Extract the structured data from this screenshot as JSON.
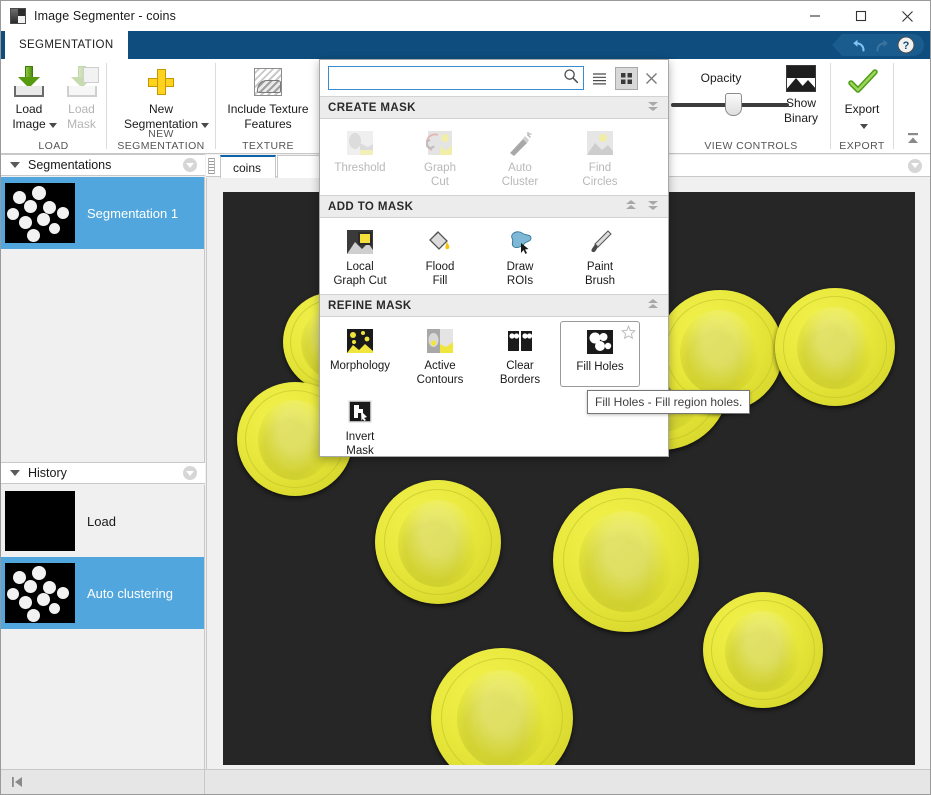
{
  "window": {
    "title": "Image Segmenter - coins",
    "app_icon": "image-segmenter-icon",
    "minimize": "minimize-icon",
    "maximize": "maximize-icon",
    "close": "close-icon"
  },
  "tabstrip": {
    "active_tab": "SEGMENTATION",
    "quick_access": {
      "undo": "undo-icon",
      "redo": "redo-icon",
      "help": "help-icon"
    }
  },
  "ribbon": {
    "groups": [
      {
        "label": "LOAD",
        "buttons": [
          {
            "label": "Load\nImage",
            "icon": "load-image-icon",
            "enabled": true,
            "has_caret": true
          },
          {
            "label": "Load\nMask",
            "icon": "load-mask-icon",
            "enabled": false,
            "has_caret": false
          }
        ]
      },
      {
        "label": "NEW SEGMENTATION",
        "buttons": [
          {
            "label": "New\nSegmentation",
            "icon": "new-segmentation-icon",
            "enabled": true,
            "has_caret": true
          }
        ]
      },
      {
        "label": "TEXTURE",
        "buttons": [
          {
            "label": "Include Texture\nFeatures",
            "icon": "texture-icon",
            "enabled": true,
            "has_caret": false
          }
        ]
      },
      {
        "label": "VIEW CONTROLS",
        "buttons": [
          {
            "label": "Opacity",
            "icon": "opacity-slider",
            "enabled": true,
            "has_caret": false
          },
          {
            "label": "Show\nBinary",
            "icon": "show-binary-icon",
            "enabled": true,
            "has_caret": false
          }
        ]
      },
      {
        "label": "EXPORT",
        "buttons": [
          {
            "label": "Export",
            "icon": "export-icon",
            "enabled": true,
            "has_caret": true
          }
        ]
      }
    ],
    "collapse_icon": "ribbon-collapse-icon"
  },
  "gallery": {
    "search": {
      "value": "",
      "placeholder": "",
      "icon": "search-icon"
    },
    "view_list_icon": "list-view-icon",
    "view_grid_icon": "grid-view-icon",
    "view_mode": "grid",
    "close_icon": "close-icon",
    "sections": [
      {
        "title": "CREATE MASK",
        "scroll_up": false,
        "scroll_down": true,
        "items": [
          {
            "label": "Threshold",
            "icon": "threshold-icon",
            "enabled": false
          },
          {
            "label": "Graph\nCut",
            "icon": "graph-cut-icon",
            "enabled": false
          },
          {
            "label": "Auto\nCluster",
            "icon": "auto-cluster-icon",
            "enabled": false
          },
          {
            "label": "Find\nCircles",
            "icon": "find-circles-icon",
            "enabled": false
          }
        ]
      },
      {
        "title": "ADD TO MASK",
        "scroll_up": true,
        "scroll_down": true,
        "items": [
          {
            "label": "Local\nGraph Cut",
            "icon": "local-graph-cut-icon",
            "enabled": true
          },
          {
            "label": "Flood\nFill",
            "icon": "flood-fill-icon",
            "enabled": true
          },
          {
            "label": "Draw\nROIs",
            "icon": "draw-rois-icon",
            "enabled": true
          },
          {
            "label": "Paint\nBrush",
            "icon": "paint-brush-icon",
            "enabled": true
          }
        ]
      },
      {
        "title": "REFINE MASK",
        "scroll_up": true,
        "scroll_down": false,
        "items": [
          {
            "label": "Morphology",
            "icon": "morphology-icon",
            "enabled": true
          },
          {
            "label": "Active\nContours",
            "icon": "active-contours-icon",
            "enabled": true
          },
          {
            "label": "Clear\nBorders",
            "icon": "clear-borders-icon",
            "enabled": true
          },
          {
            "label": "Fill Holes",
            "icon": "fill-holes-icon",
            "enabled": true,
            "hovered": true,
            "favorite_icon": "star-icon"
          },
          {
            "label": "Invert\nMask",
            "icon": "invert-mask-icon",
            "enabled": true
          }
        ]
      }
    ]
  },
  "tooltip": {
    "text": "Fill Holes - Fill region holes."
  },
  "segmentations_panel": {
    "title": "Segmentations",
    "twisty": "chevron-down-icon",
    "menu_icon": "panel-menu-icon",
    "items": [
      {
        "label": "Segmentation 1",
        "selected": true,
        "thumbnail": "mask-thumbnail"
      }
    ]
  },
  "history_panel": {
    "title": "History",
    "twisty": "chevron-down-icon",
    "menu_icon": "panel-menu-icon",
    "items": [
      {
        "label": "Load",
        "selected": false,
        "thumbnail": "black-thumbnail"
      },
      {
        "label": "Auto clustering",
        "selected": true,
        "thumbnail": "mask-thumbnail"
      }
    ]
  },
  "image_panel": {
    "tab_label": "coins",
    "menu_icon": "panel-menu-icon",
    "grip_icon": "drag-grip-icon",
    "image_name": "coins-segmented-image",
    "mask_color": "#e6e63a",
    "background_color": "#262626"
  },
  "statusbar": {
    "collapse_icon": "collapse-left-panel-icon"
  },
  "colors": {
    "tab_blue": "#0e4d7d",
    "selection_blue": "#51a7dd",
    "accent_link": "#0e63a8",
    "mask_yellow": "#e6e63a"
  }
}
